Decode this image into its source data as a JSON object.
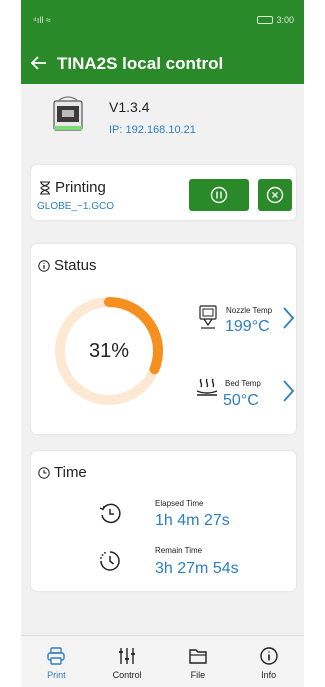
{
  "status_bar": {
    "signal": "⁴ıll ≈",
    "time": "3:00"
  },
  "app_bar": {
    "title": "TINA2S local control"
  },
  "device": {
    "version": "V1.3.4",
    "ip": "IP: 192.168.10.21"
  },
  "print_job": {
    "title": "Printing",
    "filename": "GLOBE_~1.GCO"
  },
  "status": {
    "title": "Status",
    "progress_label": "31%",
    "progress": 0.31,
    "nozzle": {
      "label": "Nozzle Temp",
      "value": "199°C"
    },
    "bed": {
      "label": "Bed Temp",
      "value": "50°C"
    }
  },
  "time": {
    "title": "Time",
    "elapsed": {
      "label": "Elapsed Time",
      "value": "1h 4m 27s"
    },
    "remain": {
      "label": "Remain Time",
      "value": "3h 27m 54s"
    }
  },
  "nav": {
    "print": "Print",
    "control": "Control",
    "file": "File",
    "info": "Info"
  },
  "colors": {
    "brand": "#2a8a2a",
    "accent": "#2c7fc0",
    "progress": "#f5901e",
    "progress_track": "#fde9d3"
  },
  "icons": [
    "arrow-left-icon",
    "printer-icon",
    "hourglass-icon",
    "pause-icon",
    "stop-icon",
    "info-icon",
    "nozzle-icon",
    "bed-heat-icon",
    "chevron-right-icon",
    "history-icon",
    "timer-icon",
    "sliders-icon",
    "folder-icon"
  ]
}
